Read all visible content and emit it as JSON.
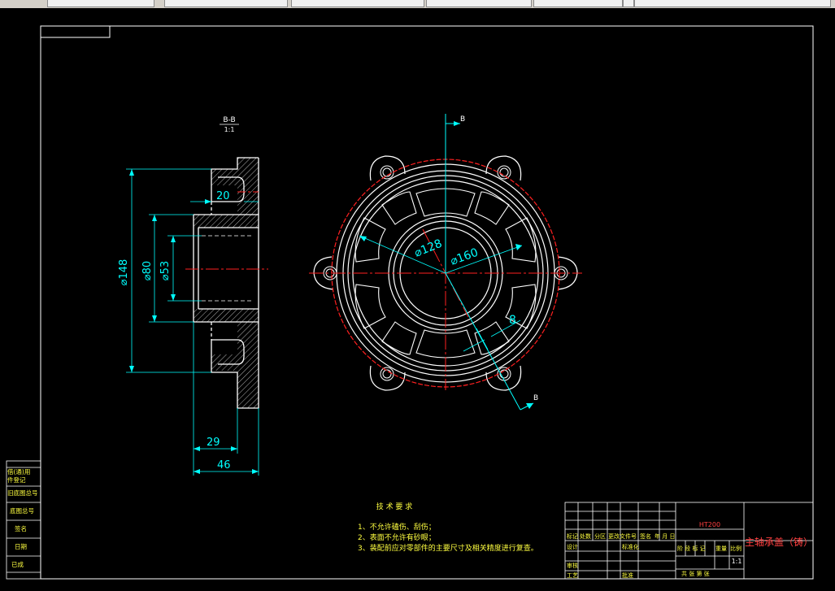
{
  "tabs": [
    "",
    "",
    "",
    "",
    "",
    "",
    ""
  ],
  "section_view": {
    "label": "B-B",
    "scale": "1:1"
  },
  "dimensions": {
    "d148": "⌀148",
    "d80": "⌀80",
    "d53": "⌀53",
    "w20": "20",
    "w29": "29",
    "w46": "46",
    "d128": "⌀128",
    "d160": "⌀160",
    "r8": "8",
    "cut_top": "B",
    "cut_bottom": "B"
  },
  "tech_req": {
    "title": "技 术 要 求",
    "items": [
      "1、不允许磕伤、刮伤；",
      "2、表面不允许有砂眼；",
      "3、装配前应对零部件的主要尺寸及相关精度进行复查。"
    ]
  },
  "title_block": {
    "material": "HT200",
    "part_name": "主轴承盖（铸）",
    "scale_value": "1:1",
    "labels": {
      "mark": "标记",
      "count": "处数",
      "zone": "分区",
      "doc_no": "更改文件号",
      "sign": "签名",
      "date_ymd": "年 月 日",
      "design": "设计",
      "standard": "标准化",
      "review": "审核",
      "craft": "工艺",
      "approve": "批准",
      "stage": "阶 段 标 记",
      "weight": "重量",
      "scale": "比例",
      "sheets": "共   张   第   张"
    }
  },
  "side_panel": {
    "rows": [
      "借(通)用",
      "件登记",
      "旧底图总号",
      "底图总号",
      "签名",
      "日期",
      "已成"
    ]
  },
  "colors": {
    "outline": "#ffffff",
    "dimension": "#00ffff",
    "centerline": "#ff2020",
    "text": "#ffff40",
    "part_name": "#ff4040"
  }
}
